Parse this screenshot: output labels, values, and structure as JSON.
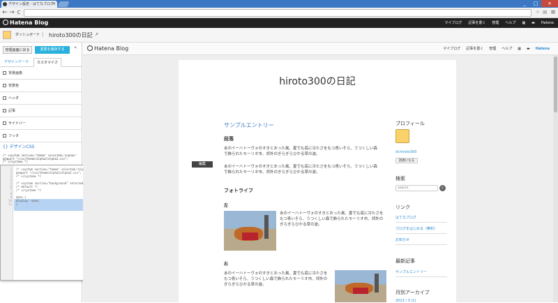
{
  "browser": {
    "tab_title": "デザイン設定 - はてなブログ",
    "tab_close": "×",
    "nav": {
      "back": "←",
      "forward": "→",
      "reload": "C"
    },
    "window_controls": {
      "minimize": "_",
      "maximize": "□",
      "close": "×"
    }
  },
  "hatena_bar": {
    "logo": "Hatena Blog",
    "menu": [
      "マイブログ",
      "記事を書く",
      "管理",
      "ヘルプ",
      "Hatena"
    ]
  },
  "dashboard": {
    "link": "ダッシュボード",
    "separator": "|",
    "blog_title": "hiroto300の日記"
  },
  "sidebar": {
    "back_button": "管理画面に戻る",
    "save_button": "変更を保存する",
    "collapse": "«",
    "tabs": [
      "デザインテーマ",
      "カスタマイズ"
    ],
    "items": [
      "背景画像",
      "背景色",
      "ヘッダ",
      "記事",
      "サイドバー",
      "フッタ"
    ],
    "css_heading": "{} デザインCSS",
    "css_preview": [
      "/* <system section=\"theme\" selected=\"alpha2\"",
      "@import \"/css/theme/alpha2/alpha2.css\";",
      "/* </system> */"
    ]
  },
  "editor": {
    "line_numbers": [
      "1",
      "2",
      "3",
      "4",
      "5",
      "6",
      "7",
      "8",
      "9",
      "10",
      "11"
    ],
    "lines": [
      "/* <system section=\"theme\" selected=\"alpha2\"> */",
      "@import \"/css/theme/alpha2/alpha2.css\";",
      "/* </system> */",
      "",
      "/* <system section=\"background\" selected=\"default\"> */",
      "/* default */",
      "/* </system> */",
      "",
      "date {",
      "display: none;",
      "}"
    ]
  },
  "preview": {
    "logo": "Hatena Blog",
    "menu": [
      "マイブログ",
      "記事を書く",
      "管理",
      "ヘルプ",
      "Hatena"
    ],
    "title": "hiroto300の日記",
    "edit_button": "編集",
    "entry_title": "サンプルエントリー",
    "section_paragraph": "段落",
    "para1": "あのイーハトーヴォのすきとおった風、夏でも底に冷たさをもつ青いそら、うつくしい森で飾られたモーリオ市、郊外のぎらぎらひかる草の波。",
    "para2": "あのイーハトーヴォのすきとおった風、夏でも底に冷たさをもつ青いそら、うつくしい森で飾られたモーリオ市、郊外のぎらぎらひかる草の波。",
    "section_photo": "フォトライフ",
    "left_label": "左",
    "right_label": "右",
    "photo_text_left": "あのイーハトーヴォのすきとおった風、夏でも底に冷たさをもつ青いそら、うつくしい森で飾られたモーリオ市、郊外のぎらぎらひかる草の波。",
    "photo_text_right": "あのイーハトーヴォのすきとおった風、夏でも底に冷たさをもつ青いそら、うつくしい森で飾られたモーリオ市、郊外のぎらぎらひかる草の波。",
    "sidebar": {
      "profile_heading": "プロフィール",
      "profile_id": "id:hiroto300",
      "reader_button": "読者になる",
      "search_heading": "検索",
      "search_placeholder": "Search",
      "links_heading": "リンク",
      "links": [
        "はてなブログ",
        "ブログをはじめる（無料）",
        "お知らせ"
      ],
      "recent_heading": "最新記事",
      "recent": [
        "サンプルエントリー"
      ],
      "archive_heading": "月別アーカイブ",
      "archive": [
        "2013 / 3 (1)"
      ]
    }
  },
  "colors": {
    "accent": "#2ab0dc",
    "link": "#2a8bd0",
    "hatena_bar": "#222222",
    "tabbar": "#3c77c4"
  }
}
